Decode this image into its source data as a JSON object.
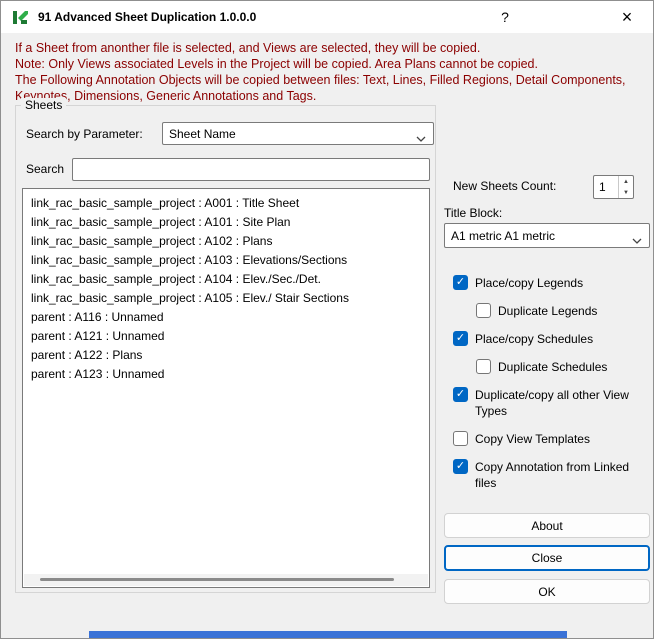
{
  "window": {
    "title": "91 Advanced Sheet Duplication 1.0.0.0",
    "help_button": "?",
    "close_button": "×"
  },
  "icons": {
    "app": "green-app-logo-icon",
    "combo_chevron": "chevron-down-icon",
    "spinner_up": "▲",
    "spinner_down": "▼",
    "checkmark": "✓"
  },
  "notes": {
    "line1": "If a Sheet from anonther file is selected, and Views are selected, they will be copied.",
    "line2": "Note: Only Views associated Levels in the Project will be copied. Area Plans cannot be copied.",
    "line3": "The Following Annotation Objects will be copied between files: Text, Lines, Filled Regions, Detail Components, Keynotes, Dimensions, Generic Annotations and Tags."
  },
  "sheets_group": {
    "title": "Sheets",
    "search_by_parameter_label": "Search by Parameter:",
    "parameter_value": "Sheet Name",
    "search_label": "Search",
    "search_value": "",
    "items": [
      "link_rac_basic_sample_project : A001 : Title Sheet",
      "link_rac_basic_sample_project : A101 : Site Plan",
      "link_rac_basic_sample_project : A102 : Plans",
      "link_rac_basic_sample_project : A103 : Elevations/Sections",
      "link_rac_basic_sample_project : A104 : Elev./Sec./Det.",
      "link_rac_basic_sample_project : A105 : Elev./ Stair Sections",
      "parent : A116 : Unnamed",
      "parent : A121 : Unnamed",
      "parent : A122 : Plans",
      "parent : A123 : Unnamed"
    ]
  },
  "right_panel": {
    "new_sheets_count_label": "New Sheets Count:",
    "new_sheets_count_value": "1",
    "title_block_label": "Title Block:",
    "title_block_value": "A1 metric A1 metric",
    "checkboxes": [
      {
        "label": "Place/copy Legends",
        "checked": true,
        "indent": false
      },
      {
        "label": "Duplicate Legends",
        "checked": false,
        "indent": true
      },
      {
        "label": "Place/copy Schedules",
        "checked": true,
        "indent": false
      },
      {
        "label": "Duplicate Schedules",
        "checked": false,
        "indent": true
      },
      {
        "label": "Duplicate/copy all other View Types",
        "checked": true,
        "indent": false
      },
      {
        "label": "Copy View Templates",
        "checked": false,
        "indent": false
      },
      {
        "label": "Copy Annotation from Linked files",
        "checked": true,
        "indent": false
      }
    ],
    "buttons": {
      "about": "About",
      "close": "Close",
      "ok": "OK"
    }
  }
}
